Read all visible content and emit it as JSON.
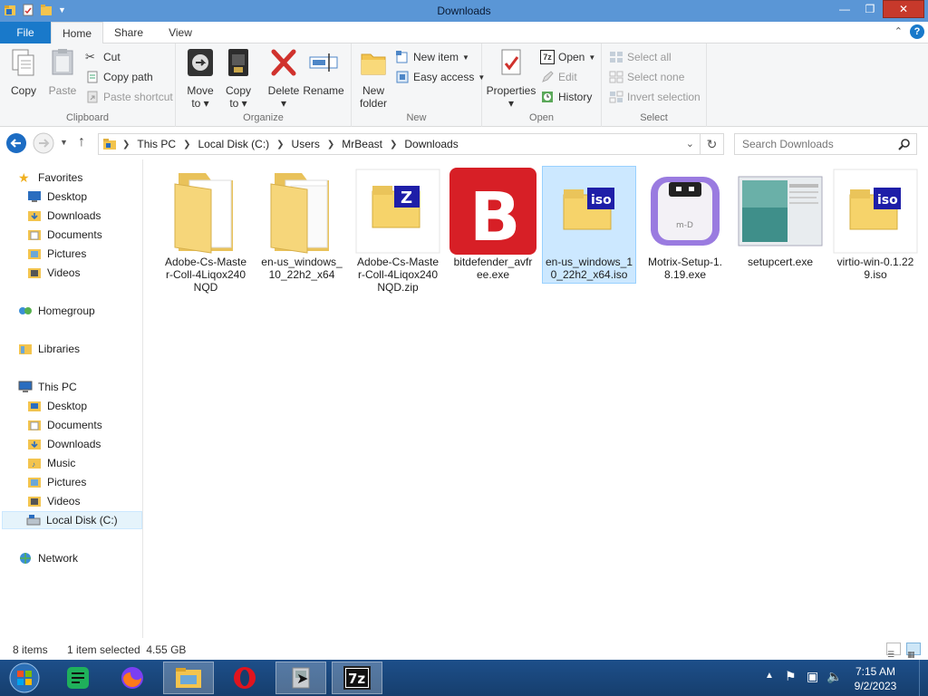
{
  "window": {
    "title": "Downloads"
  },
  "ribbon_tabs": {
    "file": "File",
    "home": "Home",
    "share": "Share",
    "view": "View"
  },
  "clipboard": {
    "copy": "Copy",
    "paste": "Paste",
    "cut": "Cut",
    "copy_path": "Copy path",
    "paste_shortcut": "Paste shortcut",
    "label": "Clipboard"
  },
  "organize": {
    "move_to": "Move",
    "move_to2": "to",
    "copy_to": "Copy",
    "copy_to2": "to",
    "delete": "Delete",
    "rename": "Rename",
    "label": "Organize"
  },
  "new": {
    "new_folder": "New",
    "new_folder2": "folder",
    "new_item": "New item",
    "easy_access": "Easy access",
    "label": "New"
  },
  "open": {
    "properties": "Properties",
    "open": "Open",
    "edit": "Edit",
    "history": "History",
    "label": "Open"
  },
  "select": {
    "select_all": "Select all",
    "select_none": "Select none",
    "invert": "Invert selection",
    "label": "Select"
  },
  "address": {
    "crumbs": [
      "This PC",
      "Local Disk (C:)",
      "Users",
      "MrBeast",
      "Downloads"
    ]
  },
  "search": {
    "placeholder": "Search Downloads"
  },
  "nav": {
    "favorites": "Favorites",
    "fav_items": [
      "Desktop",
      "Downloads",
      "Documents",
      "Pictures",
      "Videos"
    ],
    "homegroup": "Homegroup",
    "libraries": "Libraries",
    "this_pc": "This PC",
    "pc_items": [
      "Desktop",
      "Documents",
      "Downloads",
      "Music",
      "Pictures",
      "Videos",
      "Local Disk (C:)"
    ],
    "network": "Network"
  },
  "files": [
    {
      "name": "Adobe-Cs-Master-Coll-4Liqox240NQD",
      "kind": "folder"
    },
    {
      "name": "en-us_windows_10_22h2_x64",
      "kind": "folder"
    },
    {
      "name": "Adobe-Cs-Master-Coll-4Liqox240NQD.zip",
      "kind": "zip"
    },
    {
      "name": "bitdefender_avfree.exe",
      "kind": "bitdefender"
    },
    {
      "name": "en-us_windows_10_22h2_x64.iso",
      "kind": "iso",
      "selected": true
    },
    {
      "name": "Motrix-Setup-1.8.19.exe",
      "kind": "motrix"
    },
    {
      "name": "setupcert.exe",
      "kind": "setup"
    },
    {
      "name": "virtio-win-0.1.229.iso",
      "kind": "iso"
    }
  ],
  "status": {
    "count": "8 items",
    "selection": "1 item selected  4.55 GB"
  },
  "clock": {
    "time": "7:15 AM",
    "date": "9/2/2023"
  },
  "colors": {
    "titlebar": "#5a96d6",
    "file_tab": "#1979ca",
    "selection": "#cce8ff",
    "close": "#c7392b"
  }
}
